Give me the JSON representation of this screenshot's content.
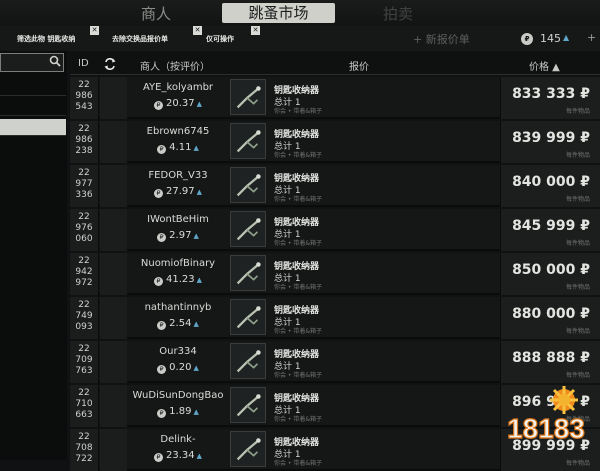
{
  "tabs": [
    {
      "label": "商人"
    },
    {
      "label": "跳蚤市场"
    },
    {
      "label": "拍卖"
    }
  ],
  "filters": [
    {
      "label": "筛选此物 钥匙收纳"
    },
    {
      "label": "去除交换品报价单"
    },
    {
      "label": "仅可操作"
    }
  ],
  "new_offer_label": "+ 新报价单",
  "player_rating": "145",
  "columns": {
    "id": "ID",
    "trader": "商人（按评价）",
    "offer": "报价",
    "price": "价格 ▲"
  },
  "rows": [
    {
      "id": "22\n986\n543",
      "trader": "AYE_kolyambr",
      "rating": "20.37",
      "item": "钥匙收纳器",
      "qty": "总计 1",
      "req": "你会 • 带着&箱子",
      "price": "833 333 ₽",
      "each": "每件物品"
    },
    {
      "id": "22\n986\n238",
      "trader": "Ebrown6745",
      "rating": "4.11",
      "item": "钥匙收纳器",
      "qty": "总计 1",
      "req": "你会 • 带着&箱子",
      "price": "839 999 ₽",
      "each": "每件物品"
    },
    {
      "id": "22\n977\n336",
      "trader": "FEDOR_V33",
      "rating": "27.97",
      "item": "钥匙收纳器",
      "qty": "总计 1",
      "req": "你会 • 带着&箱子",
      "price": "840 000 ₽",
      "each": "每件物品"
    },
    {
      "id": "22\n976\n060",
      "trader": "IWontBeHim",
      "rating": "2.97",
      "item": "钥匙收纳器",
      "qty": "总计 1",
      "req": "你会 • 带着&箱子",
      "price": "845 999 ₽",
      "each": "每件物品"
    },
    {
      "id": "22\n942\n972",
      "trader": "NuomiofBinary",
      "rating": "41.23",
      "item": "钥匙收纳器",
      "qty": "总计 1",
      "req": "你会 • 带着&箱子",
      "price": "850 000 ₽",
      "each": "每件物品"
    },
    {
      "id": "22\n749\n093",
      "trader": "nathantinnyb",
      "rating": "2.54",
      "item": "钥匙收纳器",
      "qty": "总计 1",
      "req": "你会 • 带着&箱子",
      "price": "880 000 ₽",
      "each": "每件物品"
    },
    {
      "id": "22\n709\n763",
      "trader": "Our334",
      "rating": "0.20",
      "item": "钥匙收纳器",
      "qty": "总计 1",
      "req": "你会 • 带着&箱子",
      "price": "888 888 ₽",
      "each": "每件物品"
    },
    {
      "id": "22\n710\n663",
      "trader": "WuDiSunDongBao",
      "rating": "1.89",
      "item": "钥匙收纳器",
      "qty": "总计 1",
      "req": "你会 • 带着&箱子",
      "price": "896 999 ₽",
      "each": "每件物品"
    },
    {
      "id": "22\n708\n722",
      "trader": "Delink-",
      "rating": "23.34",
      "item": "钥匙收纳器",
      "qty": "总计 1",
      "req": "你会 • 带着&箱子",
      "price": "899 999 ₽",
      "each": "每件物品"
    }
  ],
  "watermark_text": "18183",
  "colors": {
    "accent_blue": "#5fa7c9",
    "selected_tab": "#cfd0c9"
  }
}
